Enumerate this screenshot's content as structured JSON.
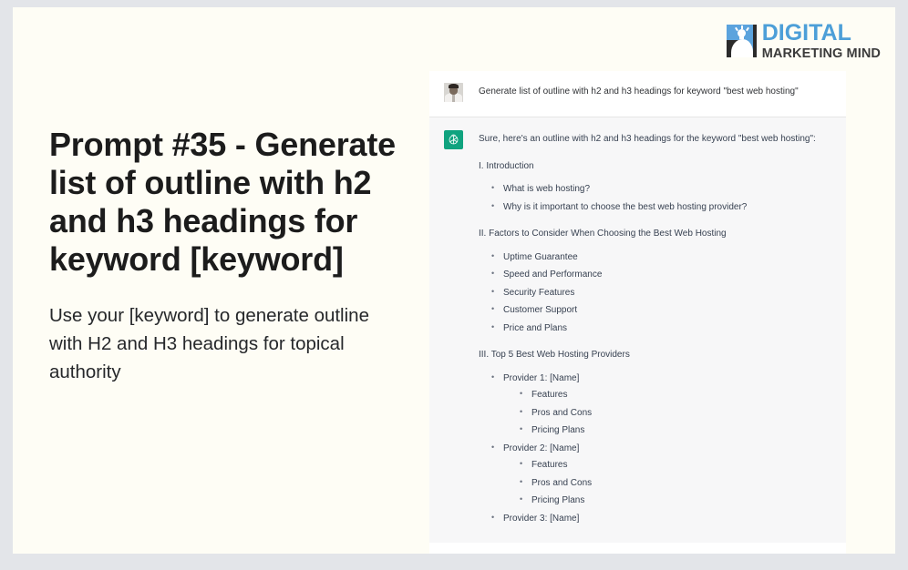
{
  "brand": {
    "logo_title": "DIGITAL",
    "logo_subtitle": "MARKETING MIND",
    "blue": "#4d9fd8",
    "dark": "#3b3b3b"
  },
  "slide": {
    "title": "Prompt #35 - Generate list of outline with h2 and h3 headings for keyword [keyword]",
    "subtitle": "Use your [keyword] to generate outline with H2 and H3 headings for topical authority",
    "background": "#fefdf5"
  },
  "chat": {
    "accent": "#10a37f",
    "user": {
      "avatar_icon": "user-photo-avatar",
      "message": "Generate list of outline with h2 and h3 headings for keyword \"best web hosting\""
    },
    "assistant": {
      "avatar_icon": "openai-logo-icon",
      "lead": "Sure, here's an outline with h2 and h3 headings for the keyword \"best web hosting\":",
      "sections": [
        {
          "heading": "I. Introduction",
          "items": [
            {
              "text": "What is web hosting?"
            },
            {
              "text": "Why is it important to choose the best web hosting provider?"
            }
          ]
        },
        {
          "heading": "II. Factors to Consider When Choosing the Best Web Hosting",
          "items": [
            {
              "text": "Uptime Guarantee"
            },
            {
              "text": "Speed and Performance"
            },
            {
              "text": "Security Features"
            },
            {
              "text": "Customer Support"
            },
            {
              "text": "Price and Plans"
            }
          ]
        },
        {
          "heading": "III. Top 5 Best Web Hosting Providers",
          "items": [
            {
              "text": "Provider 1: [Name]",
              "children": [
                "Features",
                "Pros and Cons",
                "Pricing Plans"
              ]
            },
            {
              "text": "Provider 2: [Name]",
              "children": [
                "Features",
                "Pros and Cons",
                "Pricing Plans"
              ]
            },
            {
              "text": "Provider 3: [Name]"
            }
          ]
        }
      ]
    }
  }
}
